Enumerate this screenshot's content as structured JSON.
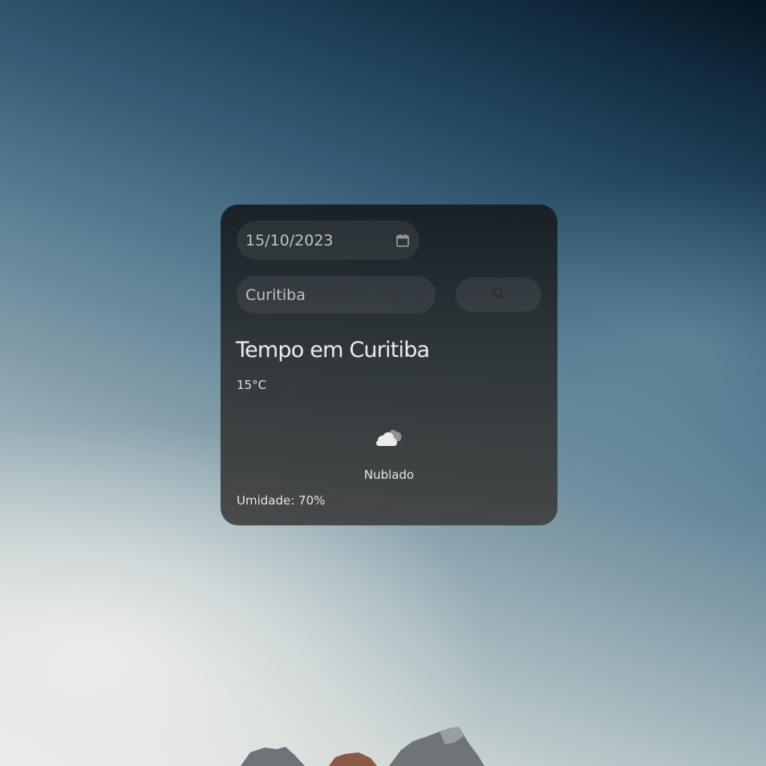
{
  "weather_card": {
    "date_value": "15/10/2023",
    "city_value": "Curitiba",
    "title": "Tempo em Curitiba",
    "temperature": "15°C",
    "condition": "Nublado",
    "humidity": "Umidade: 70%",
    "icons": {
      "calendar": "calendar-icon",
      "search": "search-icon",
      "weather": "cloudy-icon"
    }
  },
  "colors": {
    "card_background": "#1e2428",
    "field_background": "#3a4043",
    "text": "#e6e6e6",
    "field_text": "#bfc3c6"
  }
}
